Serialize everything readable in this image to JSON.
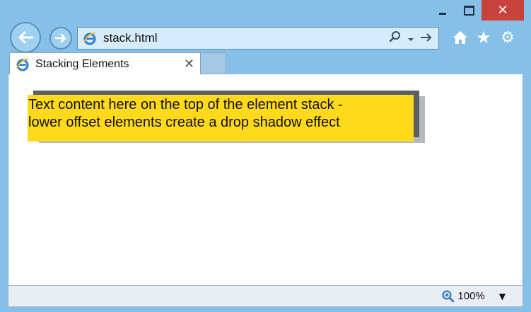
{
  "window": {
    "controls": {
      "minimize": "minimize",
      "maximize": "maximize",
      "close": "✕"
    }
  },
  "nav": {
    "back_icon": "back-arrow-icon",
    "forward_icon": "forward-arrow-icon"
  },
  "address_bar": {
    "value": "stack.html",
    "site_icon": "ie-logo-icon",
    "search_icon": "search-icon",
    "dropdown_icon": "chevron-down-icon",
    "go_icon": "go-arrow-icon"
  },
  "toolbar": {
    "home_icon": "home-icon",
    "favorites_icon": "star-icon",
    "tools_icon": "gear-icon"
  },
  "tabs": [
    {
      "title": "Stacking Elements",
      "close": "✕"
    }
  ],
  "page": {
    "stack_text_line1": "Text content here on the top of the element stack -",
    "stack_text_line2": "lower offset elements create a drop shadow effect",
    "colors": {
      "top_layer": "#ffd91c",
      "middle_layer": "#595f64",
      "bottom_layer": "#b4babe"
    }
  },
  "status_bar": {
    "zoom": "100%",
    "zoom_icon": "zoom-icon",
    "dropdown": "▼"
  }
}
